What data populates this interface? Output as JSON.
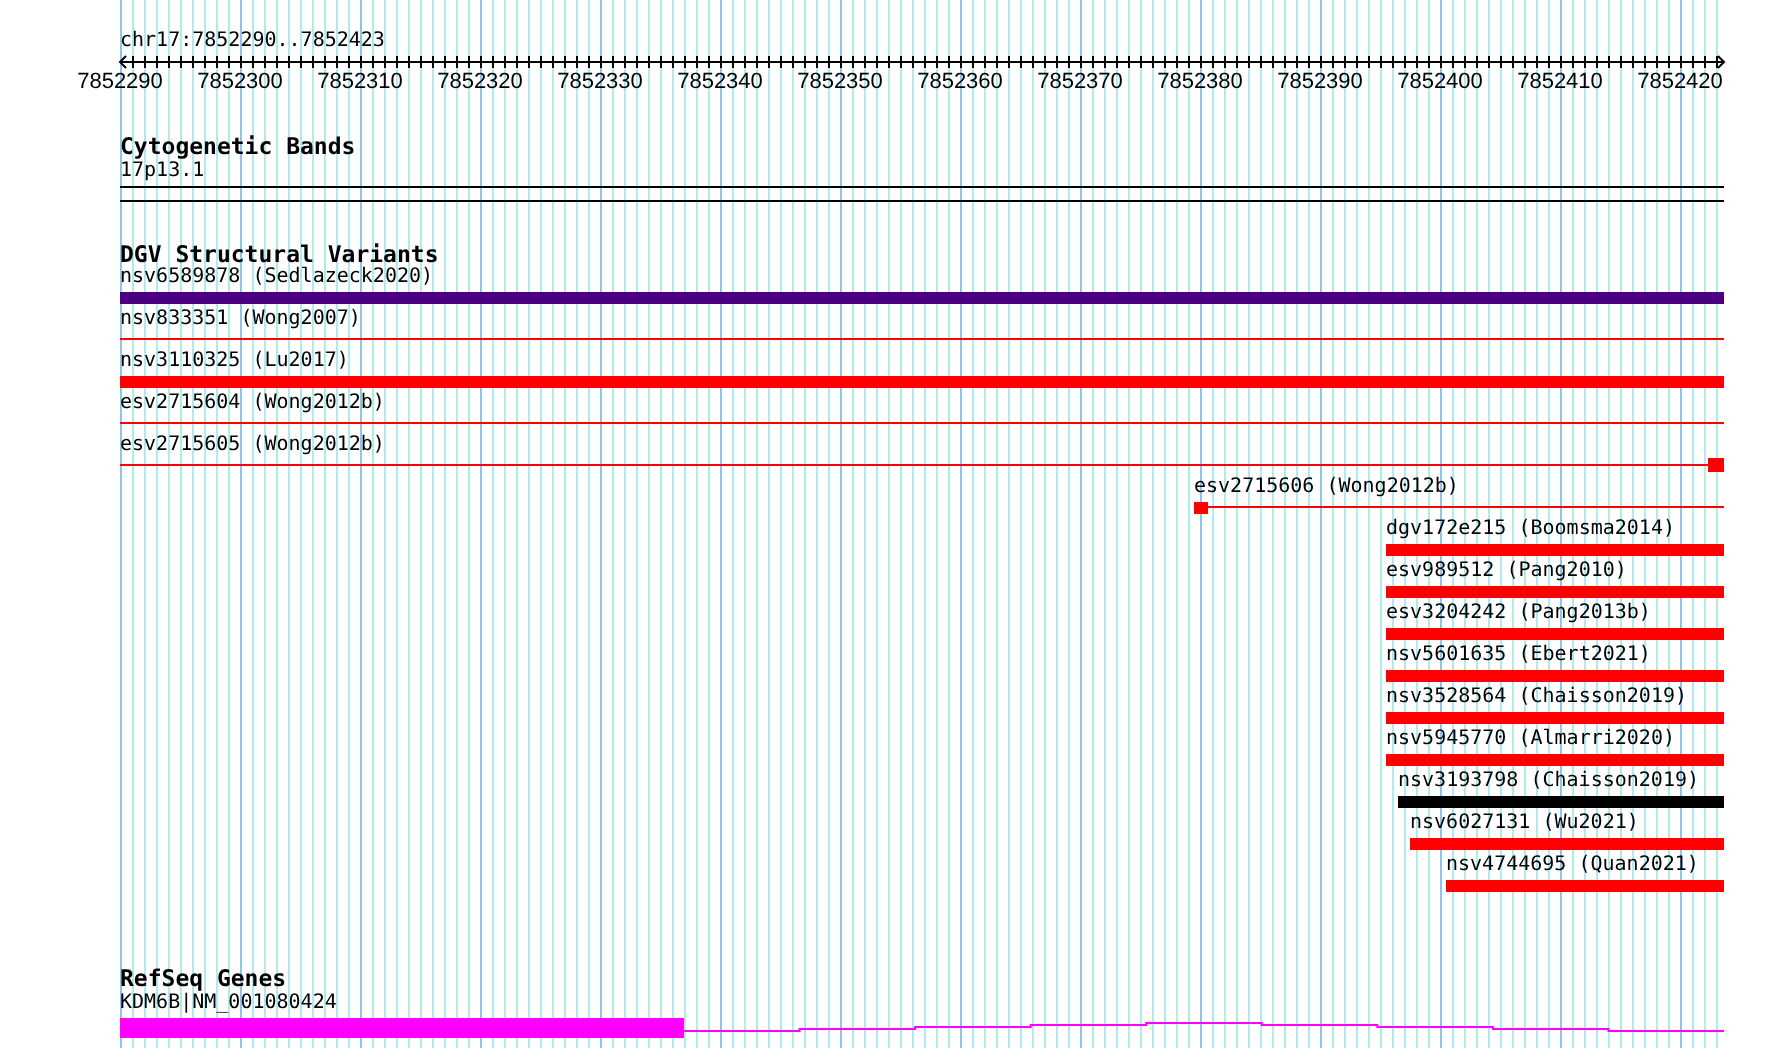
{
  "ruler": {
    "title": "chr17:7852290..7852423",
    "tick_labels": [
      "7852290",
      "7852300",
      "7852310",
      "7852320",
      "7852330",
      "7852340",
      "7852350",
      "7852360",
      "7852370",
      "7852380",
      "7852390",
      "7852400",
      "7852410",
      "7852420"
    ]
  },
  "cytogenetic_bands": {
    "title": "Cytogenetic Bands",
    "band": "17p13.1"
  },
  "dgv_structural_variants": {
    "title": "DGV Structural Variants",
    "features": [
      {
        "label": "nsv6589878 (Sedlazeck2020)",
        "kind": "thick",
        "color": "#4b0082"
      },
      {
        "label": "nsv833351 (Wong2007)",
        "kind": "thin",
        "color": "#ff0000"
      },
      {
        "label": "nsv3110325 (Lu2017)",
        "kind": "thick",
        "color": "#ff0000"
      },
      {
        "label": "esv2715604 (Wong2012b)",
        "kind": "thin",
        "color": "#ff0000"
      },
      {
        "label": "esv2715605 (Wong2012b)",
        "kind": "thin_end_block",
        "color": "#ff0000"
      },
      {
        "label": "esv2715606 (Wong2012b)",
        "kind": "thin_start_block",
        "color": "#ff0000"
      },
      {
        "label": "dgv172e215 (Boomsma2014)",
        "kind": "thick",
        "color": "#ff0000"
      },
      {
        "label": "esv989512 (Pang2010)",
        "kind": "thick",
        "color": "#ff0000"
      },
      {
        "label": "esv3204242 (Pang2013b)",
        "kind": "thick",
        "color": "#ff0000"
      },
      {
        "label": "nsv5601635 (Ebert2021)",
        "kind": "thick",
        "color": "#ff0000"
      },
      {
        "label": "nsv3528564 (Chaisson2019)",
        "kind": "thick",
        "color": "#ff0000"
      },
      {
        "label": "nsv5945770 (Almarri2020)",
        "kind": "thick",
        "color": "#ff0000"
      },
      {
        "label": "nsv3193798 (Chaisson2019)",
        "kind": "thick",
        "color": "#000000"
      },
      {
        "label": "nsv6027131 (Wu2021)",
        "kind": "thick",
        "color": "#ff0000"
      },
      {
        "label": "nsv4744695 (Quan2021)",
        "kind": "thick",
        "color": "#ff0000"
      }
    ]
  },
  "refseq_genes": {
    "title": "RefSeq Genes",
    "genes": [
      {
        "label": "KDM6B|NM_001080424",
        "color": "#ff00ff"
      }
    ]
  }
}
